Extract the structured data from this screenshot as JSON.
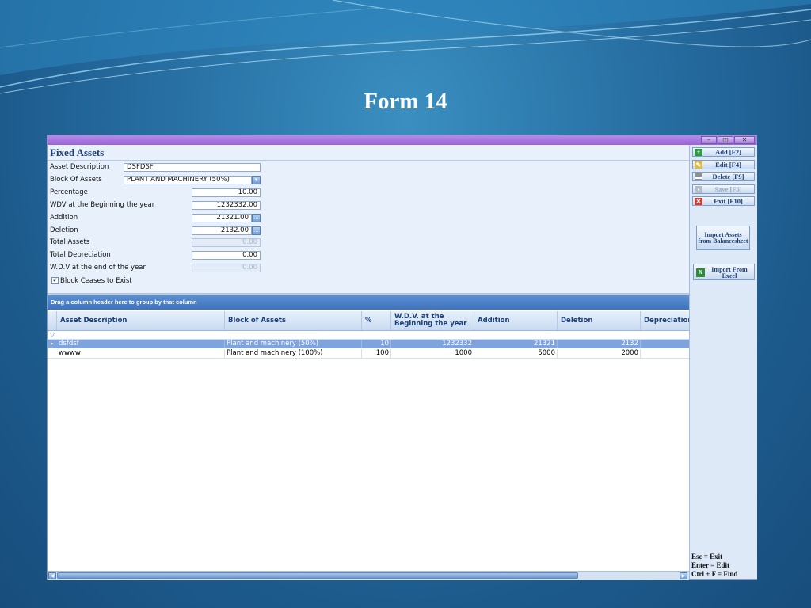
{
  "slide": {
    "title": "Form 14"
  },
  "window": {
    "controls": {
      "minimize": "–",
      "restore": "◫",
      "close": "✕"
    }
  },
  "form": {
    "heading": "Fixed Assets",
    "fields": {
      "asset_description": {
        "label": "Asset Description",
        "value": "DSFDSF"
      },
      "block_of_assets": {
        "label": "Block Of Assets",
        "value": "PLANT AND MACHINERY (50%)"
      },
      "percentage": {
        "label": "Percentage",
        "value": "10.00"
      },
      "wdv_beginning": {
        "label": "WDV at the  Beginning the year",
        "value": "1232332.00"
      },
      "addition": {
        "label": "Addition",
        "value": "21321.00"
      },
      "deletion": {
        "label": "Deletion",
        "value": "2132.00"
      },
      "total_assets": {
        "label": "Total Assets",
        "value": "0.00"
      },
      "total_depreciation": {
        "label": "Total Depreciation",
        "value": "0.00"
      },
      "wdv_end": {
        "label": "W.D.V at the end of the year",
        "value": "0.00"
      }
    },
    "block_ceases": {
      "label": "Block Ceases to Exist",
      "checked": true
    }
  },
  "grid": {
    "group_hint": "Drag a column header here to group by that column",
    "columns": [
      "Asset Description",
      "Block of Assets",
      "%",
      "W.D.V. at the Beginning the year",
      "Addition",
      "Deletion",
      "Depreciation"
    ],
    "rows": [
      {
        "asset_description": "dsfdsf",
        "block": "Plant and machinery (50%)",
        "pct": "10",
        "wdv": "1232332",
        "addition": "21321",
        "deletion": "2132",
        "depreciation": ""
      },
      {
        "asset_description": "wwww",
        "block": "Plant and machinery (100%)",
        "pct": "100",
        "wdv": "1000",
        "addition": "5000",
        "deletion": "2000",
        "depreciation": ""
      }
    ]
  },
  "toolbar": {
    "add": "Add [F2]",
    "edit": "Edit [F4]",
    "delete": "Delete [F9]",
    "save": "Save [F5]",
    "exit": "Exit [F10]",
    "import_balancesheet": "Import Assets from Balancesheet",
    "import_excel": "Import From Excel"
  },
  "shortcuts": [
    "Esc = Exit",
    "Enter = Edit",
    "Ctrl + F = Find"
  ]
}
